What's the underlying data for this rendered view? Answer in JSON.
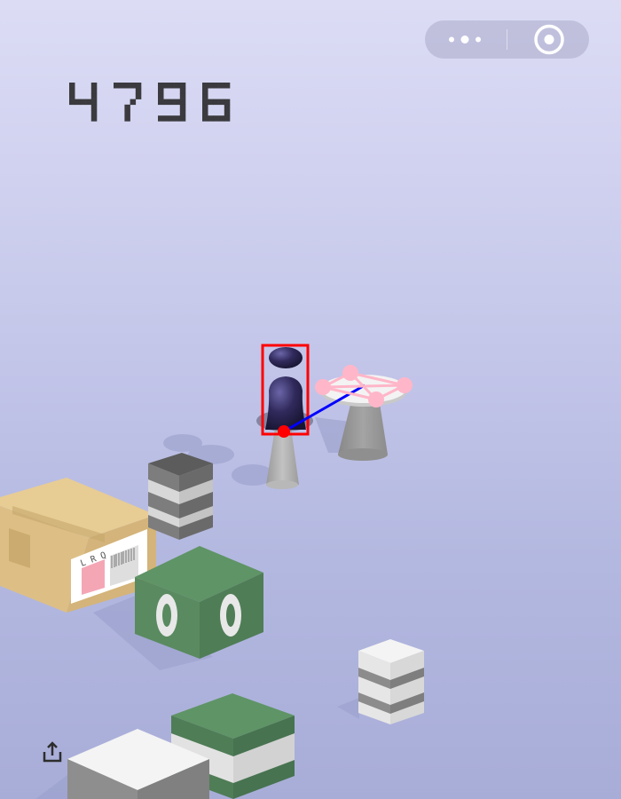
{
  "game": {
    "score": "4796"
  },
  "capsule": {
    "more_icon": "more-dots-icon",
    "close_icon": "target-close-icon"
  },
  "box": {
    "label_text": "L R Q"
  },
  "toolbar": {
    "share_icon": "share-upload-icon"
  },
  "colors": {
    "background_top": "#dcdcf5",
    "background_bottom": "#a8add8",
    "score": "#3b3b3f",
    "piece": "#2e2a55",
    "overlay_box": "#ff0000",
    "overlay_line": "#0000ff",
    "overlay_points": "#ffb6c9",
    "green_block": "#5f9466"
  }
}
